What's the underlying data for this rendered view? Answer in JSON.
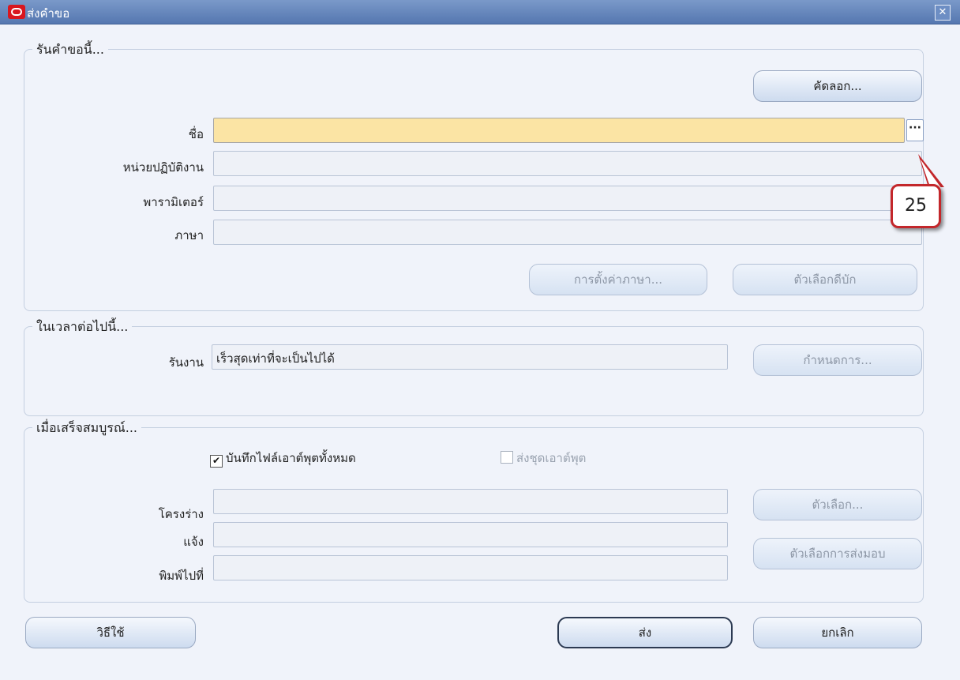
{
  "window": {
    "title": "ส่งคำขอ",
    "close_glyph": "✕"
  },
  "run_request": {
    "legend": "รันคำขอนี้...",
    "copy_button": "คัดลอก...",
    "name_label": "ชื่อ",
    "name_value": "",
    "lov_glyph": "···",
    "operating_unit_label": "หน่วยปฏิบัติงาน",
    "parameters_label": "พารามิเตอร์",
    "language_label": "ภาษา",
    "language_settings_button": "การตั้งค่าภาษา...",
    "debug_options_button": "ตัวเลือกดีบัก"
  },
  "at_these_times": {
    "legend": "ในเวลาต่อไปนี้...",
    "run_job_label": "รันงาน",
    "run_job_value": "เร็วสุดเท่าที่จะเป็นไปได้",
    "schedule_button": "กำหนดการ..."
  },
  "upon_completion": {
    "legend": "เมื่อเสร็จสมบูรณ์...",
    "save_output_label": "บันทึกไฟล์เอาต์พุตทั้งหมด",
    "save_output_checked": true,
    "burst_output_label": "ส่งชุดเอาต์พุต",
    "burst_output_checked": false,
    "layout_label": "โครงร่าง",
    "notify_label": "แจ้ง",
    "print_to_label": "พิมพ์ไปที่",
    "options_button": "ตัวเลือก...",
    "delivery_options_button": "ตัวเลือกการส่งมอบ"
  },
  "footer": {
    "help_button": "วิธีใช้",
    "submit_button": "ส่ง",
    "cancel_button": "ยกเลิก"
  },
  "annotation": {
    "callout_number": "25"
  },
  "colors": {
    "required_field": "#fbe4a4",
    "title_bar": "#5577b0",
    "callout_border": "#c3272b"
  }
}
